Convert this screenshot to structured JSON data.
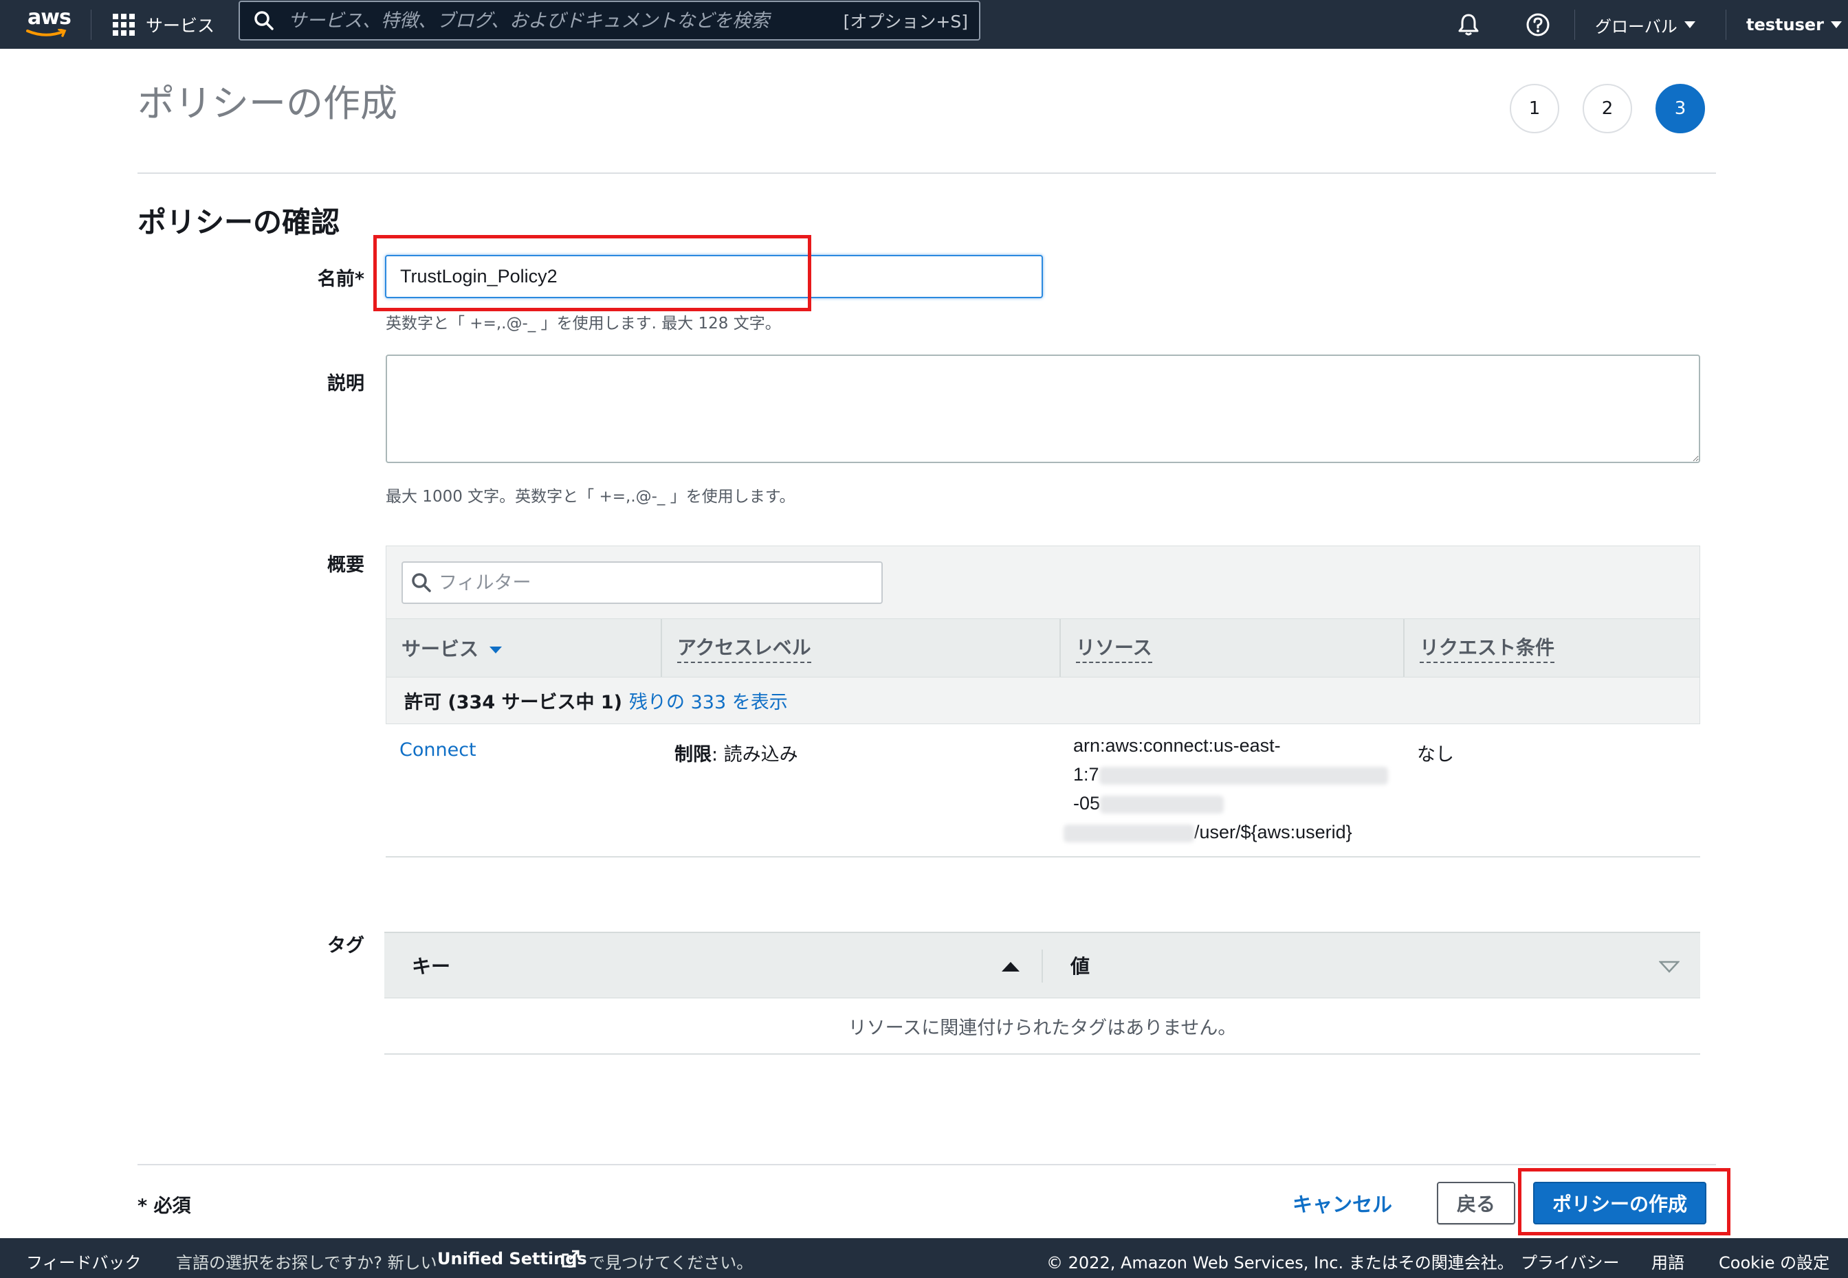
{
  "topnav": {
    "logo_text": "aws",
    "services_label": "サービス",
    "search_placeholder": "サービス、特徴、ブログ、およびドキュメントなどを検索",
    "search_shortcut": "[オプション+S]",
    "region_label": "グローバル",
    "user_label": "testuser"
  },
  "page": {
    "title": "ポリシーの作成",
    "steps": [
      "1",
      "2",
      "3"
    ],
    "active_step": 3,
    "section_title": "ポリシーの確認"
  },
  "form": {
    "name_label": "名前*",
    "name_value": "TrustLogin_Policy2",
    "name_hint": "英数字と「 +=,.@-_ 」を使用します. 最大 128 文字。",
    "description_label": "説明",
    "description_value": "",
    "description_hint": "最大 1000 文字。英数字と「 +=,.@-_ 」を使用します。",
    "summary_label": "概要",
    "tags_label": "タグ"
  },
  "summary": {
    "filter_placeholder": "フィルター",
    "columns": [
      "サービス",
      "アクセスレベル",
      "リソース",
      "リクエスト条件"
    ],
    "group_row": {
      "bold": "許可 (334 サービス中 1)",
      "link": "残りの 333 を表示"
    },
    "rows": [
      {
        "service": "Connect",
        "access_prefix": "制限",
        "access_value": ": 読み込み",
        "resource_lines": [
          "arn:aws:connect:us-east-",
          "1:7",
          "-05",
          "/user/${aws:userid}"
        ],
        "condition": "なし"
      }
    ]
  },
  "tags": {
    "columns": [
      "キー",
      "値"
    ],
    "empty_text": "リソースに関連付けられたタグはありません。"
  },
  "actions": {
    "required_note": "* 必須",
    "cancel": "キャンセル",
    "back": "戻る",
    "create": "ポリシーの作成"
  },
  "footer": {
    "feedback": "フィードバック",
    "lang_prompt": "言語の選択をお探しですか? 新しい",
    "unified_settings": "Unified Settings",
    "lang_suffix": "で見つけてください。",
    "copyright": "© 2022, Amazon Web Services, Inc. またはその関連会社。",
    "privacy": "プライバシー",
    "terms": "用語",
    "cookie": "Cookie の設定"
  },
  "colors": {
    "nav_bg": "#232f3e",
    "primary": "#0f6fc6",
    "highlight": "#e8191b"
  }
}
